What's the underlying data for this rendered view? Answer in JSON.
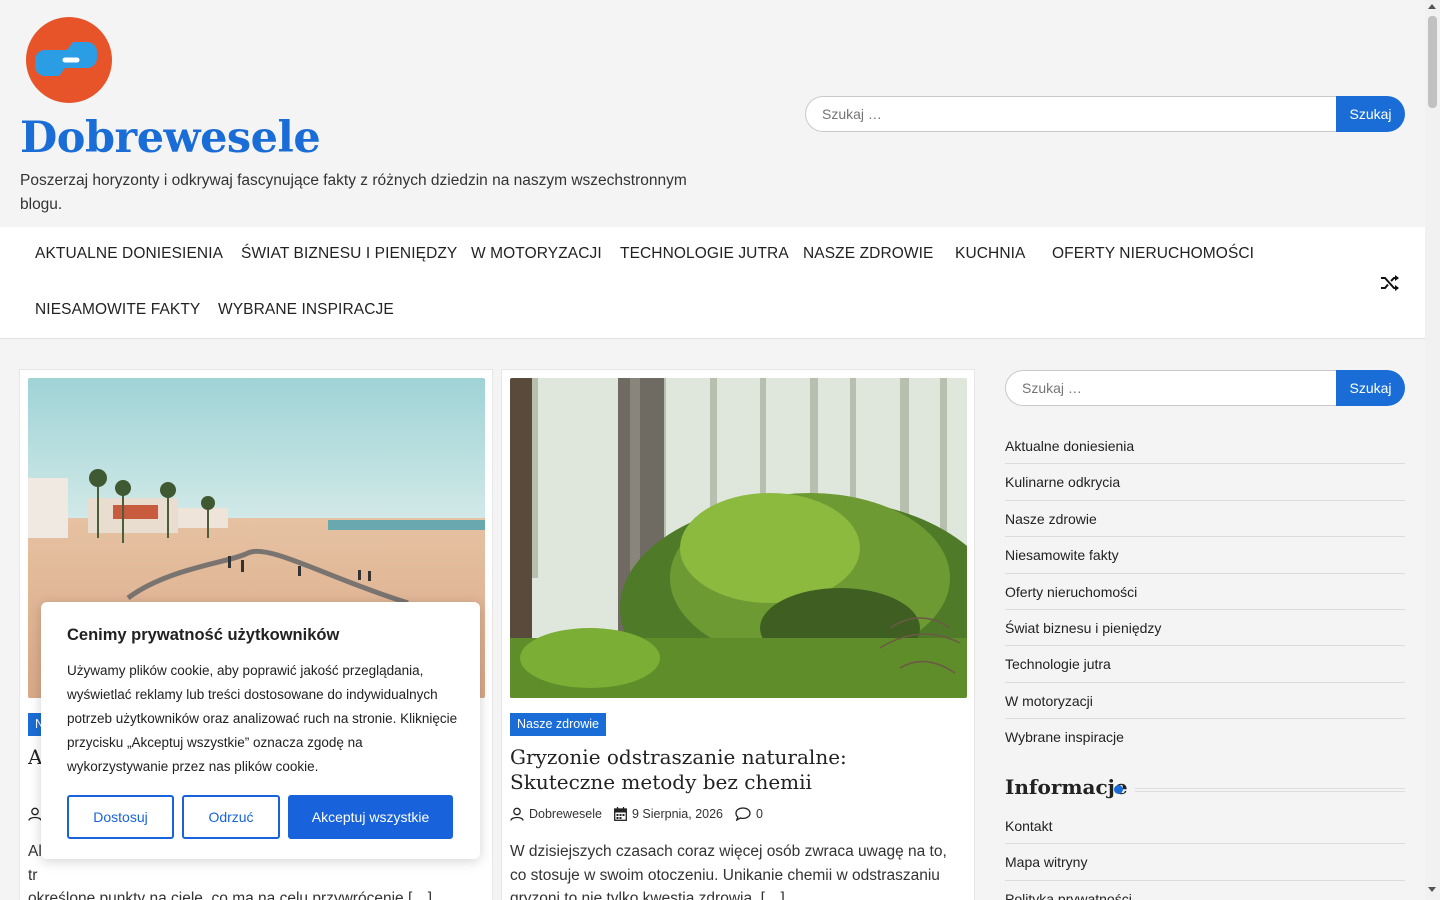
{
  "site": {
    "title": "Dobrewesele",
    "tagline": "Poszerzaj horyzonty i odkrywaj fascynujące fakty z różnych dziedzin na naszym wszechstronnym blogu.",
    "accent_color": "#1a6dd6",
    "logo_icon": "medical-cross-logo"
  },
  "search": {
    "placeholder": "Szukaj …",
    "button_label": "Szukaj"
  },
  "nav": {
    "items": [
      "AKTUALNE DONIESIENIA",
      "ŚWIAT BIZNESU I PIENIĘDZY",
      "W MOTORYZACJI",
      "TECHNOLOGIE JUTRA",
      "NASZE ZDROWIE",
      "KUCHNIA",
      "OFERTY NIERUCHOMOŚCI",
      "NIESAMOWITE FAKTY",
      "WYBRANE INSPIRACJE"
    ],
    "shuffle_icon": "shuffle-icon"
  },
  "posts": [
    {
      "category": "N",
      "title": "A",
      "excerpt_visible": "Al",
      "excerpt_line2": "tr",
      "excerpt_tail": "określone punkty na ciele, co ma na celu przywrócenie […]"
    },
    {
      "category": "Nasze zdrowie",
      "title": "Gryzonie odstraszanie naturalne: Skuteczne metody bez chemii",
      "author": "Dobrewesele",
      "date": "9 Sierpnia, 2026",
      "comments": "0",
      "excerpt": "W dzisiejszych czasach coraz więcej osób zwraca uwagę na to, co stosuje w swoim otoczeniu. Unikanie chemii w odstraszaniu gryzoni to nie tylko kwestia zdrowia, […]"
    }
  ],
  "sidebar": {
    "categories": [
      "Aktualne doniesienia",
      "Kulinarne odkrycia",
      "Nasze zdrowie",
      "Niesamowite fakty",
      "Oferty nieruchomości",
      "Świat biznesu i pieniędzy",
      "Technologie jutra",
      "W motoryzacji",
      "Wybrane inspiracje"
    ],
    "info_title": "Informacje",
    "info_links": [
      "Kontakt",
      "Mapa witryny",
      "Polityka prywatności"
    ]
  },
  "cookie": {
    "title": "Cenimy prywatność użytkowników",
    "text": "Używamy plików cookie, aby poprawić jakość przeglądania, wyświetlać reklamy lub treści dostosowane do indywidualnych potrzeb użytkowników oraz analizować ruch na stronie. Kliknięcie przycisku „Akceptuj wszystkie” oznacza zgodę na wykorzystywanie przez nas plików cookie.",
    "customize_label": "Dostosuj",
    "reject_label": "Odrzuć",
    "accept_label": "Akceptuj wszystkie",
    "button_color": "#1863dc"
  }
}
